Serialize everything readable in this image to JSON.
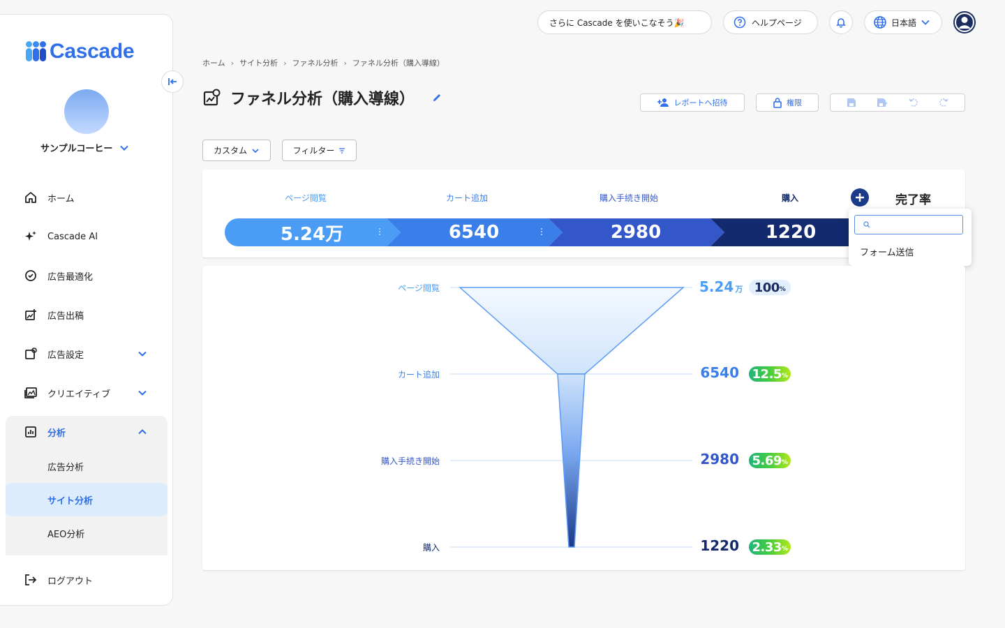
{
  "brand": {
    "name": "Cascade"
  },
  "account": {
    "name": "サンプルコーヒー"
  },
  "sidebar": {
    "items": [
      {
        "label": "ホーム",
        "icon": "home-icon"
      },
      {
        "label": "Cascade AI",
        "icon": "sparkle-icon"
      },
      {
        "label": "広告最適化",
        "icon": "optimize-icon"
      },
      {
        "label": "広告出稿",
        "icon": "ad-post-icon"
      },
      {
        "label": "広告設定",
        "icon": "ad-settings-icon"
      },
      {
        "label": "クリエイティブ",
        "icon": "creative-icon"
      },
      {
        "label": "分析",
        "icon": "analytics-icon"
      }
    ],
    "analysis_sub": [
      "広告分析",
      "サイト分析",
      "AEO分析"
    ],
    "logout": "ログアウト"
  },
  "topbar": {
    "promo": "さらに Cascade を使いこなそう🎉",
    "help": "ヘルプページ",
    "language": "日本語"
  },
  "breadcrumb": [
    "ホーム",
    "サイト分析",
    "ファネル分析",
    "ファネル分析（購入導線）"
  ],
  "page": {
    "title": "ファネル分析（購入導線）"
  },
  "actions": {
    "invite": "レポートへ招待",
    "permission": "権限"
  },
  "filters": {
    "period": "カスタム",
    "filter": "フィルター"
  },
  "steps": [
    {
      "label": "ページ閲覧",
      "value": "5.24万",
      "color": "#4a9cf5"
    },
    {
      "label": "カート追加",
      "value": "6540",
      "color": "#3a7eea"
    },
    {
      "label": "購入手続き開始",
      "value": "2980",
      "color": "#3357c9"
    },
    {
      "label": "購入",
      "value": "1220",
      "color": "#132b6e"
    }
  ],
  "completion": {
    "label": "完了率"
  },
  "dropdown": {
    "search_placeholder": "",
    "options": [
      "フォーム送信"
    ]
  },
  "chart_data": {
    "type": "funnel",
    "categories": [
      "ページ閲覧",
      "カート追加",
      "購入手続き開始",
      "購入"
    ],
    "values_display": [
      "5.24",
      "6540",
      "2980",
      "1220"
    ],
    "value_units": [
      "万",
      "",
      "",
      ""
    ],
    "values": [
      52400,
      6540,
      2980,
      1220
    ],
    "conversion_rates": [
      "100",
      "12.5",
      "5.69",
      "2.33"
    ],
    "rate_unit": "%"
  }
}
